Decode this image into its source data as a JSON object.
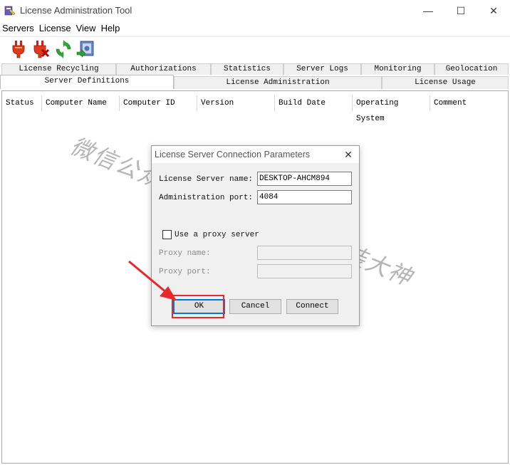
{
  "window": {
    "title": "License Administration Tool",
    "controls": {
      "minimize": "—",
      "maximize": "☐",
      "close": "✕"
    }
  },
  "menu": [
    "Servers",
    "License",
    "View",
    "Help"
  ],
  "toolbar": {
    "buttons": [
      "plug-connect-icon",
      "plug-disconnect-icon",
      "refresh-icon",
      "server-settings-icon"
    ]
  },
  "tabs": {
    "row1": [
      "License Recycling",
      "Authorizations",
      "Statistics",
      "Server Logs",
      "Monitoring",
      "Geolocation"
    ],
    "row2": [
      "Server Definitions",
      "License Administration",
      "License Usage"
    ],
    "active": "Server Definitions"
  },
  "table": {
    "columns": [
      "Status",
      "Computer Name",
      "Computer ID",
      "Version",
      "Build Date",
      "Operating System",
      "Comment"
    ]
  },
  "watermark": {
    "line1": "微信公众号：",
    "line2": "软件安装大神"
  },
  "dialog": {
    "title": "License Server Connection Parameters",
    "server_name_label": "License Server name:",
    "server_name_value": "DESKTOP-AHCM894",
    "port_label": "Administration port:",
    "port_value": "4084",
    "proxy_checkbox_label": "Use a proxy server",
    "proxy_name_label": "Proxy name:",
    "proxy_port_label": "Proxy port:",
    "ok_label": "OK",
    "cancel_label": "Cancel",
    "connect_label": "Connect"
  },
  "colors": {
    "highlight": "#e8292a",
    "default_button_border": "#0078d7"
  }
}
